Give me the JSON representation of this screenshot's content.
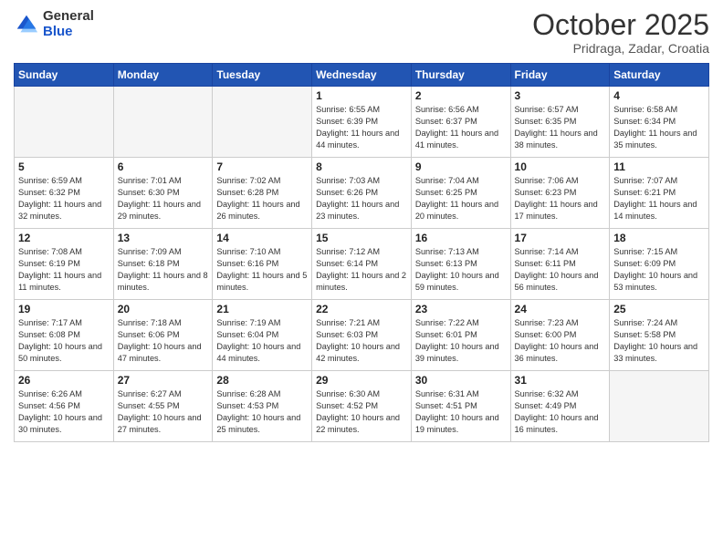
{
  "header": {
    "logo_general": "General",
    "logo_blue": "Blue",
    "title": "October 2025",
    "location": "Pridraga, Zadar, Croatia"
  },
  "calendar": {
    "days_of_week": [
      "Sunday",
      "Monday",
      "Tuesday",
      "Wednesday",
      "Thursday",
      "Friday",
      "Saturday"
    ],
    "weeks": [
      [
        {
          "day": "",
          "empty": true
        },
        {
          "day": "",
          "empty": true
        },
        {
          "day": "",
          "empty": true
        },
        {
          "day": "1",
          "sunrise": "6:55 AM",
          "sunset": "6:39 PM",
          "daylight": "11 hours and 44 minutes."
        },
        {
          "day": "2",
          "sunrise": "6:56 AM",
          "sunset": "6:37 PM",
          "daylight": "11 hours and 41 minutes."
        },
        {
          "day": "3",
          "sunrise": "6:57 AM",
          "sunset": "6:35 PM",
          "daylight": "11 hours and 38 minutes."
        },
        {
          "day": "4",
          "sunrise": "6:58 AM",
          "sunset": "6:34 PM",
          "daylight": "11 hours and 35 minutes."
        }
      ],
      [
        {
          "day": "5",
          "sunrise": "6:59 AM",
          "sunset": "6:32 PM",
          "daylight": "11 hours and 32 minutes."
        },
        {
          "day": "6",
          "sunrise": "7:01 AM",
          "sunset": "6:30 PM",
          "daylight": "11 hours and 29 minutes."
        },
        {
          "day": "7",
          "sunrise": "7:02 AM",
          "sunset": "6:28 PM",
          "daylight": "11 hours and 26 minutes."
        },
        {
          "day": "8",
          "sunrise": "7:03 AM",
          "sunset": "6:26 PM",
          "daylight": "11 hours and 23 minutes."
        },
        {
          "day": "9",
          "sunrise": "7:04 AM",
          "sunset": "6:25 PM",
          "daylight": "11 hours and 20 minutes."
        },
        {
          "day": "10",
          "sunrise": "7:06 AM",
          "sunset": "6:23 PM",
          "daylight": "11 hours and 17 minutes."
        },
        {
          "day": "11",
          "sunrise": "7:07 AM",
          "sunset": "6:21 PM",
          "daylight": "11 hours and 14 minutes."
        }
      ],
      [
        {
          "day": "12",
          "sunrise": "7:08 AM",
          "sunset": "6:19 PM",
          "daylight": "11 hours and 11 minutes."
        },
        {
          "day": "13",
          "sunrise": "7:09 AM",
          "sunset": "6:18 PM",
          "daylight": "11 hours and 8 minutes."
        },
        {
          "day": "14",
          "sunrise": "7:10 AM",
          "sunset": "6:16 PM",
          "daylight": "11 hours and 5 minutes."
        },
        {
          "day": "15",
          "sunrise": "7:12 AM",
          "sunset": "6:14 PM",
          "daylight": "11 hours and 2 minutes."
        },
        {
          "day": "16",
          "sunrise": "7:13 AM",
          "sunset": "6:13 PM",
          "daylight": "10 hours and 59 minutes."
        },
        {
          "day": "17",
          "sunrise": "7:14 AM",
          "sunset": "6:11 PM",
          "daylight": "10 hours and 56 minutes."
        },
        {
          "day": "18",
          "sunrise": "7:15 AM",
          "sunset": "6:09 PM",
          "daylight": "10 hours and 53 minutes."
        }
      ],
      [
        {
          "day": "19",
          "sunrise": "7:17 AM",
          "sunset": "6:08 PM",
          "daylight": "10 hours and 50 minutes."
        },
        {
          "day": "20",
          "sunrise": "7:18 AM",
          "sunset": "6:06 PM",
          "daylight": "10 hours and 47 minutes."
        },
        {
          "day": "21",
          "sunrise": "7:19 AM",
          "sunset": "6:04 PM",
          "daylight": "10 hours and 44 minutes."
        },
        {
          "day": "22",
          "sunrise": "7:21 AM",
          "sunset": "6:03 PM",
          "daylight": "10 hours and 42 minutes."
        },
        {
          "day": "23",
          "sunrise": "7:22 AM",
          "sunset": "6:01 PM",
          "daylight": "10 hours and 39 minutes."
        },
        {
          "day": "24",
          "sunrise": "7:23 AM",
          "sunset": "6:00 PM",
          "daylight": "10 hours and 36 minutes."
        },
        {
          "day": "25",
          "sunrise": "7:24 AM",
          "sunset": "5:58 PM",
          "daylight": "10 hours and 33 minutes."
        }
      ],
      [
        {
          "day": "26",
          "sunrise": "6:26 AM",
          "sunset": "4:56 PM",
          "daylight": "10 hours and 30 minutes."
        },
        {
          "day": "27",
          "sunrise": "6:27 AM",
          "sunset": "4:55 PM",
          "daylight": "10 hours and 27 minutes."
        },
        {
          "day": "28",
          "sunrise": "6:28 AM",
          "sunset": "4:53 PM",
          "daylight": "10 hours and 25 minutes."
        },
        {
          "day": "29",
          "sunrise": "6:30 AM",
          "sunset": "4:52 PM",
          "daylight": "10 hours and 22 minutes."
        },
        {
          "day": "30",
          "sunrise": "6:31 AM",
          "sunset": "4:51 PM",
          "daylight": "10 hours and 19 minutes."
        },
        {
          "day": "31",
          "sunrise": "6:32 AM",
          "sunset": "4:49 PM",
          "daylight": "10 hours and 16 minutes."
        },
        {
          "day": "",
          "empty": true
        }
      ]
    ]
  }
}
